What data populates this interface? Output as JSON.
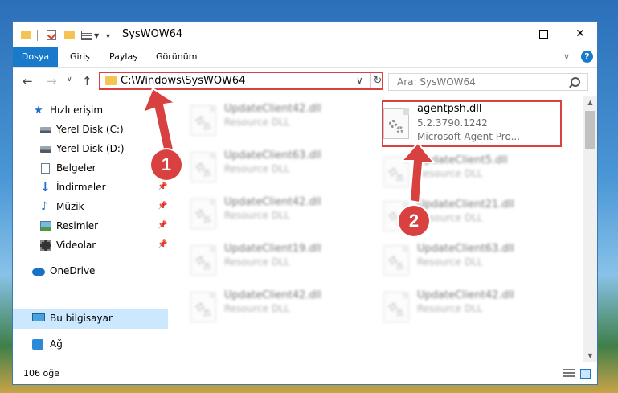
{
  "window": {
    "title": "SysWOW64",
    "controls": {
      "minimize": "",
      "maximize": "",
      "close": "✕"
    }
  },
  "ribbon": {
    "file_tab": "Dosya",
    "tabs": [
      "Giriş",
      "Paylaş",
      "Görünüm"
    ],
    "help": "?"
  },
  "address": {
    "path": "C:\\Windows\\SysWOW64",
    "search_placeholder": "Ara: SysWOW64"
  },
  "sidebar": {
    "items": [
      {
        "label": "Hızlı erişim",
        "icon": "star-icon"
      },
      {
        "label": "Yerel Disk (C:)",
        "icon": "drive-icon"
      },
      {
        "label": "Yerel Disk (D:)",
        "icon": "drive-icon"
      },
      {
        "label": "Belgeler",
        "icon": "documents-icon"
      },
      {
        "label": "İndirmeler",
        "icon": "download-icon",
        "pinned": true
      },
      {
        "label": "Müzik",
        "icon": "music-icon",
        "pinned": true
      },
      {
        "label": "Resimler",
        "icon": "pictures-icon",
        "pinned": true
      },
      {
        "label": "Videolar",
        "icon": "videos-icon",
        "pinned": true
      },
      {
        "label": "OneDrive",
        "icon": "onedrive-icon"
      },
      {
        "label": "Bu bilgisayar",
        "icon": "computer-icon",
        "selected": true
      },
      {
        "label": "Ağ",
        "icon": "network-icon"
      }
    ]
  },
  "files": {
    "left": [
      {
        "name": "UpdateClient42.dll",
        "type": "Resource DLL"
      },
      {
        "name": "UpdateClient63.dll",
        "type": "Resource DLL"
      },
      {
        "name": "UpdateClient42.dll",
        "type": "Resource DLL"
      },
      {
        "name": "UpdateClient19.dll",
        "type": "Resource DLL"
      },
      {
        "name": "UpdateClient42.dll",
        "type": "Resource DLL"
      }
    ],
    "right_highlight": {
      "name": "agentpsh.dll",
      "version": "5.2.3790.1242",
      "description": "Microsoft Agent Pro..."
    },
    "right": [
      {
        "name": "UpdateClient5.dll",
        "type": "Resource DLL"
      },
      {
        "name": "UpdateClient21.dll",
        "type": "Resource DLL"
      },
      {
        "name": "UpdateClient63.dll",
        "type": "Resource DLL"
      },
      {
        "name": "UpdateClient42.dll",
        "type": "Resource DLL"
      }
    ]
  },
  "status": {
    "item_count": "106 öğe"
  },
  "callouts": {
    "one": "1",
    "two": "2"
  },
  "colors": {
    "accent": "#1979ca",
    "highlight": "#d94040",
    "selected": "#cce8ff"
  }
}
